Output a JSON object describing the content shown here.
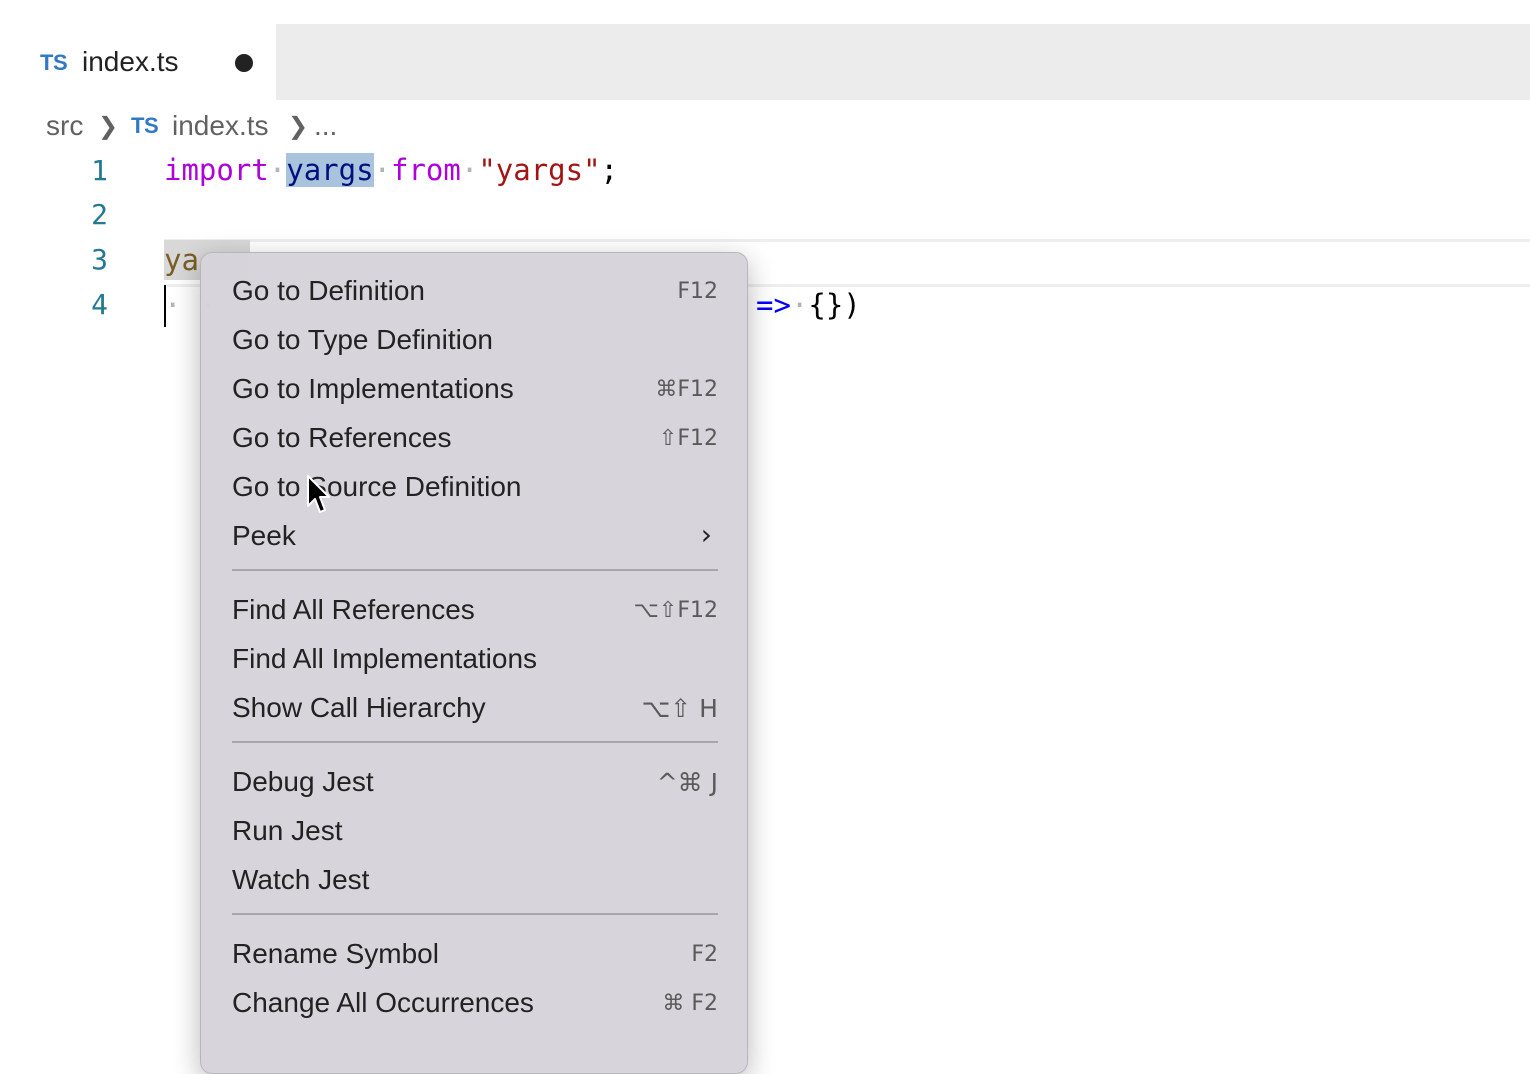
{
  "tab": {
    "icon": "TS",
    "title": "index.ts"
  },
  "breadcrumb": {
    "folder": "src",
    "file_icon": "TS",
    "file": "index.ts",
    "more": "..."
  },
  "editor": {
    "line_numbers": [
      "1",
      "2",
      "3",
      "4"
    ],
    "line1": {
      "kw1": "import",
      "ident": "yargs",
      "kw2": "from",
      "str": "\"yargs\"",
      "semi": ";"
    },
    "line3": {
      "visible": "ya"
    },
    "line4": {
      "lead": "· ·",
      "tail_arrow": "=>",
      "tail_body": "{})"
    }
  },
  "context_menu": {
    "items": [
      {
        "label": "Go to Definition",
        "shortcut": "F12"
      },
      {
        "label": "Go to Type Definition",
        "shortcut": ""
      },
      {
        "label": "Go to Implementations",
        "shortcut": "⌘F12"
      },
      {
        "label": "Go to References",
        "shortcut": "⇧F12"
      },
      {
        "label": "Go to Source Definition",
        "shortcut": ""
      },
      {
        "label": "Peek",
        "shortcut": ""
      },
      {
        "label": "Find All References",
        "shortcut": "⌥⇧F12"
      },
      {
        "label": "Find All Implementations",
        "shortcut": ""
      },
      {
        "label": "Show Call Hierarchy",
        "shortcut": "⌥⇧ H"
      },
      {
        "label": "Debug Jest",
        "shortcut": "^⌘ J"
      },
      {
        "label": "Run Jest",
        "shortcut": ""
      },
      {
        "label": "Watch Jest",
        "shortcut": ""
      },
      {
        "label": "Rename Symbol",
        "shortcut": "F2"
      },
      {
        "label": "Change All Occurrences",
        "shortcut": "⌘ F2"
      }
    ],
    "submenu_arrow": "›"
  },
  "colors": {
    "keyword": "#af00db",
    "identifier": "#001080",
    "string": "#a31515",
    "line_number": "#237893",
    "ts_icon": "#3178c6",
    "selection": "#a9c3dc"
  }
}
